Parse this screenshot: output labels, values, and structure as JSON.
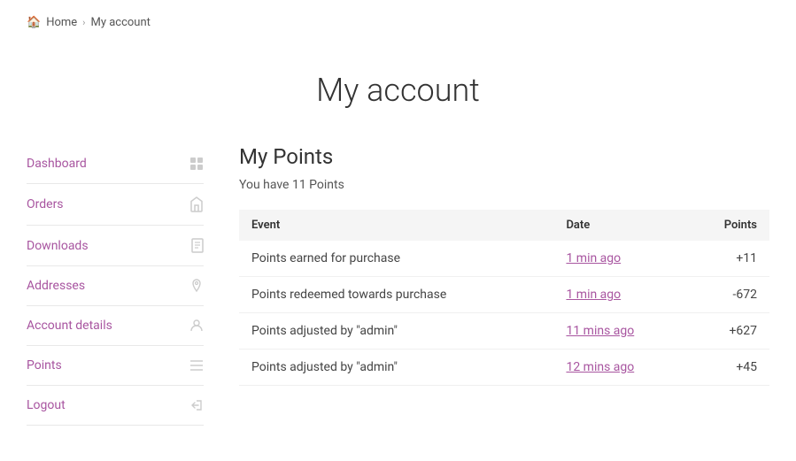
{
  "breadcrumb": {
    "home_label": "Home",
    "current_label": "My account"
  },
  "page_title": "My account",
  "sidebar": {
    "items": [
      {
        "id": "dashboard",
        "label": "Dashboard",
        "icon": "dashboard",
        "active": false
      },
      {
        "id": "orders",
        "label": "Orders",
        "icon": "orders",
        "active": false
      },
      {
        "id": "downloads",
        "label": "Downloads",
        "icon": "downloads",
        "active": false
      },
      {
        "id": "addresses",
        "label": "Addresses",
        "icon": "addresses",
        "active": false
      },
      {
        "id": "account-details",
        "label": "Account details",
        "icon": "account",
        "active": false
      },
      {
        "id": "points",
        "label": "Points",
        "icon": "points",
        "active": true
      },
      {
        "id": "logout",
        "label": "Logout",
        "icon": "logout",
        "active": false
      }
    ]
  },
  "my_points": {
    "title": "My Points",
    "summary": "You have 11 Points",
    "table": {
      "columns": [
        "Event",
        "Date",
        "Points"
      ],
      "rows": [
        {
          "event": "Points earned for purchase",
          "date": "1 min ago",
          "points": "+11"
        },
        {
          "event": "Points redeemed towards purchase",
          "date": "1 min ago",
          "points": "-672"
        },
        {
          "event": "Points adjusted by \"admin\"",
          "date": "11 mins ago",
          "points": "+627"
        },
        {
          "event": "Points adjusted by \"admin\"",
          "date": "12 mins ago",
          "points": "+45"
        }
      ]
    }
  }
}
